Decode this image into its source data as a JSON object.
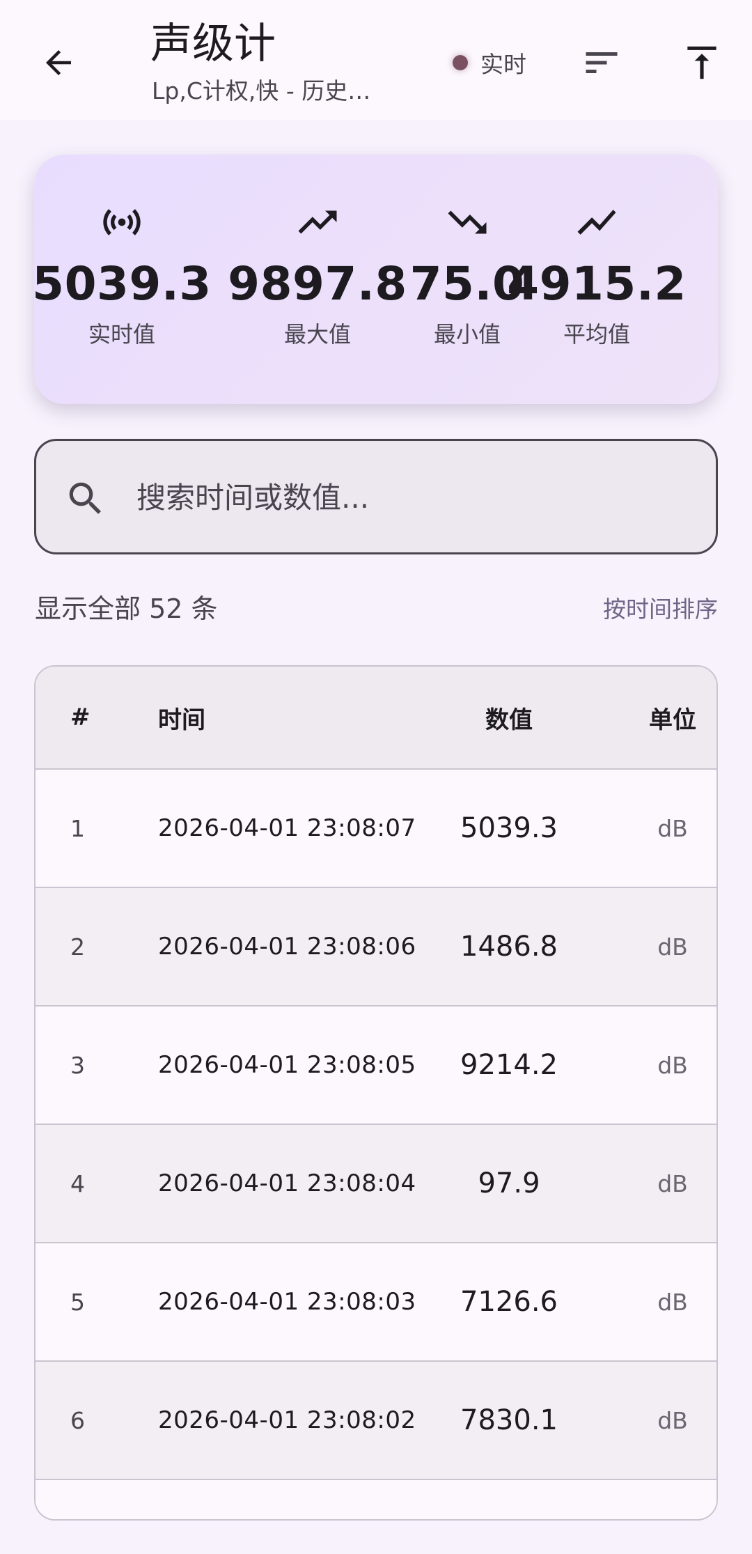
{
  "header": {
    "title": "声级计",
    "subtitle": "Lp,C计权,快 - 历史…",
    "live_label": "实时",
    "icons": {
      "back": "arrow-left-icon",
      "sort": "sort-icon",
      "top": "vertical-align-top-icon"
    },
    "accent_dot_color": "#7b5161"
  },
  "stats": [
    {
      "icon": "broadcast-icon",
      "value": "5039.3",
      "label": "实时值"
    },
    {
      "icon": "trending-up-icon",
      "value": "9897.8",
      "label": "最大值"
    },
    {
      "icon": "trending-down-icon",
      "value": "75.0",
      "label": "最小值"
    },
    {
      "icon": "show-chart-icon",
      "value": "4915.2",
      "label": "平均值"
    }
  ],
  "search": {
    "placeholder": "搜索时间或数值...",
    "value": ""
  },
  "summary": {
    "count_text": "显示全部 52 条",
    "sort_link": "按时间排序"
  },
  "table": {
    "headers": {
      "index": "#",
      "time": "时间",
      "value": "数值",
      "unit": "单位"
    },
    "rows": [
      {
        "index": "1",
        "time": "2026-04-01 23:08:07",
        "value": "5039.3",
        "unit": "dB"
      },
      {
        "index": "2",
        "time": "2026-04-01 23:08:06",
        "value": "1486.8",
        "unit": "dB"
      },
      {
        "index": "3",
        "time": "2026-04-01 23:08:05",
        "value": "9214.2",
        "unit": "dB"
      },
      {
        "index": "4",
        "time": "2026-04-01 23:08:04",
        "value": "97.9",
        "unit": "dB"
      },
      {
        "index": "5",
        "time": "2026-04-01 23:08:03",
        "value": "7126.6",
        "unit": "dB"
      },
      {
        "index": "6",
        "time": "2026-04-01 23:08:02",
        "value": "7830.1",
        "unit": "dB"
      }
    ]
  },
  "colors": {
    "background": "#f7f2fc",
    "card_gradient_start": "#e9ddff",
    "row_alt": "#f3eef3",
    "divider": "#cac4d0"
  }
}
